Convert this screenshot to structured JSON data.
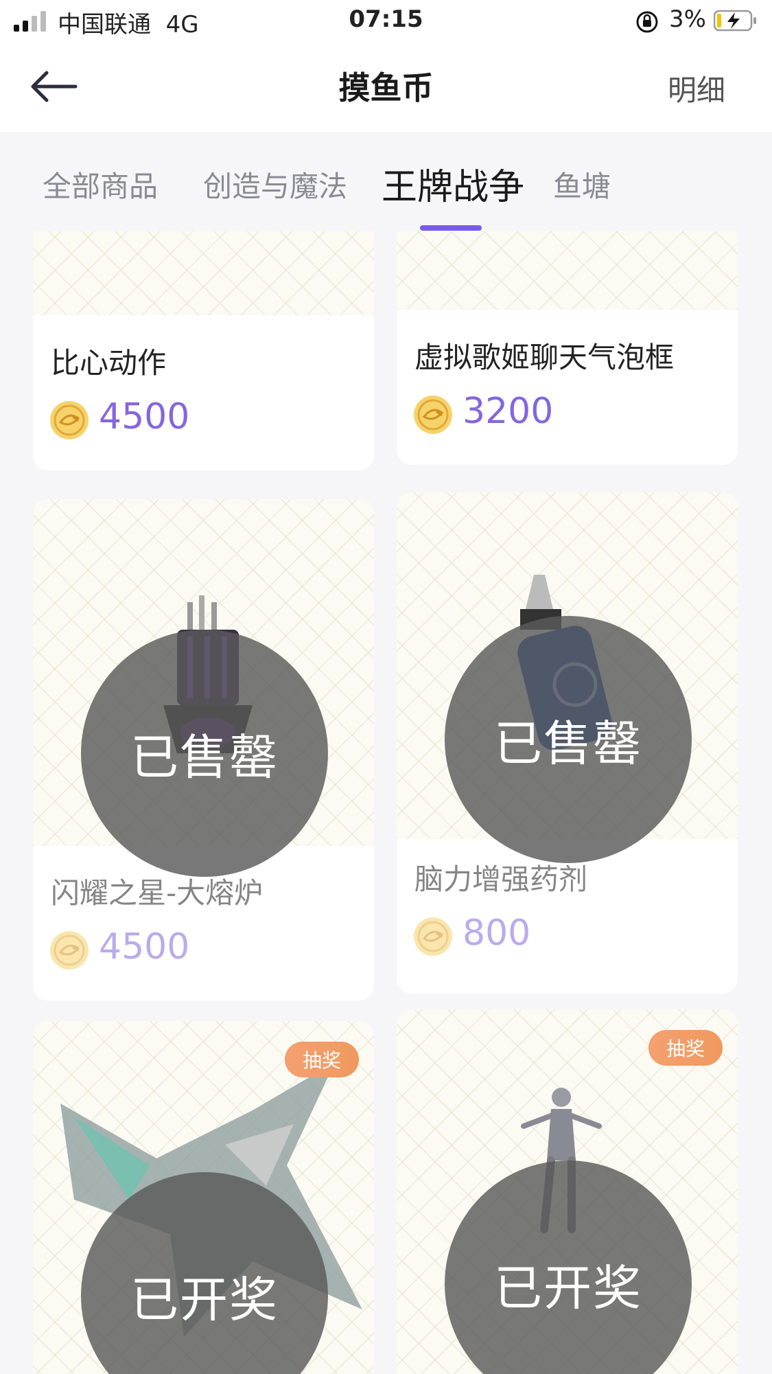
{
  "status_bar": {
    "carrier": "中国联通",
    "network": "4G",
    "time": "07:15",
    "battery": "3%"
  },
  "nav": {
    "title": "摸鱼币",
    "right_label": "明细"
  },
  "tabs": [
    {
      "label": "全部商品"
    },
    {
      "label": "创造与魔法"
    },
    {
      "label": "王牌战争",
      "active": true
    },
    {
      "label": "鱼塘"
    }
  ],
  "products": [
    {
      "name": "比心动作",
      "price": "4500",
      "status": ""
    },
    {
      "name": "虚拟歌姬聊天气泡框",
      "price": "3200",
      "status": ""
    },
    {
      "name": "闪耀之星-大熔炉",
      "price": "4500",
      "status": "已售罄"
    },
    {
      "name": "脑力增强药剂",
      "price": "800",
      "status": "已售罄"
    },
    {
      "name": "",
      "price": "",
      "badge": "抽奖",
      "status": "已开奖"
    },
    {
      "name": "",
      "price": "",
      "badge": "抽奖",
      "status": "已开奖"
    }
  ],
  "colors": {
    "accent": "#7a5ce8",
    "price": "#8565e0",
    "badge": "#f09a5e",
    "coin": "#f2c94c"
  },
  "icons": {
    "back": "back-arrow-icon",
    "coin": "fish-coin-icon"
  }
}
